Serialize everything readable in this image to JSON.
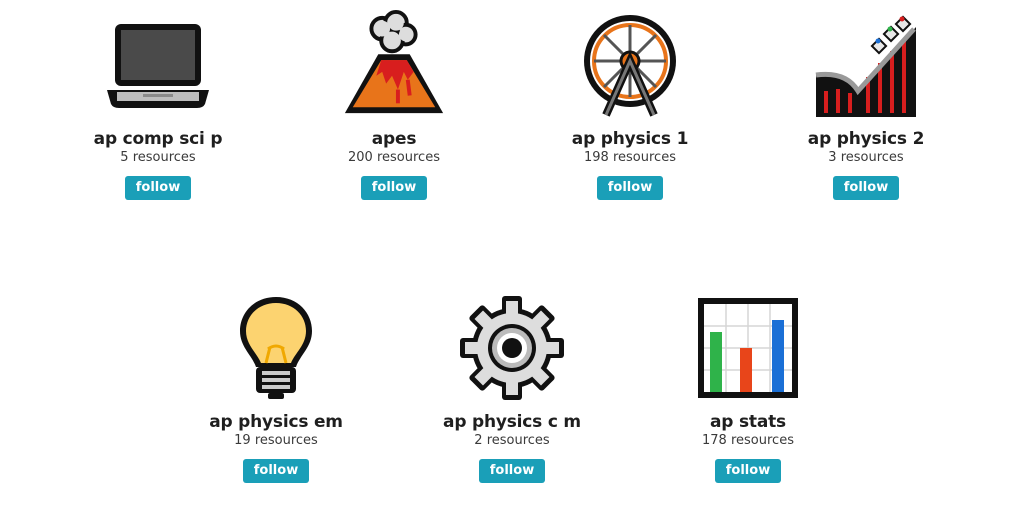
{
  "topics": [
    {
      "name": "ap comp sci p",
      "resources": "5 resources",
      "button": "follow",
      "icon": "laptop-icon"
    },
    {
      "name": "apes",
      "resources": "200 resources",
      "button": "follow",
      "icon": "volcano-icon"
    },
    {
      "name": "ap physics 1",
      "resources": "198 resources",
      "button": "follow",
      "icon": "ferris-wheel-icon"
    },
    {
      "name": "ap physics 2",
      "resources": "3 resources",
      "button": "follow",
      "icon": "roller-coaster-icon"
    },
    {
      "name": "ap physics em",
      "resources": "19 resources",
      "button": "follow",
      "icon": "light-bulb-icon"
    },
    {
      "name": "ap physics c m",
      "resources": "2 resources",
      "button": "follow",
      "icon": "gear-icon"
    },
    {
      "name": "ap stats",
      "resources": "178 resources",
      "button": "follow",
      "icon": "bar-chart-icon"
    }
  ],
  "colors": {
    "button_bg": "#1a9fb8",
    "button_text": "#ffffff"
  }
}
